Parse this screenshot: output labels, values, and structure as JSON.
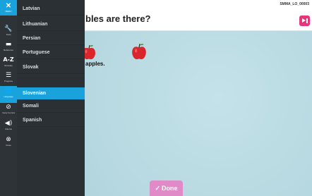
{
  "header": {
    "question_fragment": "bles are there?",
    "lo_code": "SMMA_LO_00003"
  },
  "workspace": {
    "answer_fragment": "apples."
  },
  "done_button": {
    "label": "Done",
    "icon": "check-icon"
  },
  "rail": {
    "menu": {
      "label": "MENU",
      "icon": "close-icon"
    },
    "items": [
      {
        "label": "Tools",
        "icon": "wrench-icon"
      },
      {
        "label": "Reference",
        "icon": "folder-icon"
      },
      {
        "label": "Glossary",
        "icon": "a-z-icon"
      },
      {
        "label": "Progress",
        "icon": "list-icon"
      },
      {
        "label": "Language",
        "icon": "globe-icon"
      },
      {
        "label": "Voice Control",
        "icon": "voice-icon"
      },
      {
        "label": "Volume",
        "icon": "speaker-icon"
      },
      {
        "label": "Close",
        "icon": "close-circle-icon"
      }
    ]
  },
  "languages": {
    "items": [
      "Latvian",
      "Lithuanian",
      "Persian",
      "Portuguese",
      "Slovak",
      "Slovenian",
      "Somali",
      "Spanish"
    ],
    "selected": "Slovenian"
  },
  "colors": {
    "accent_blue": "#1aa2dc",
    "panel_dark": "#2b3035",
    "apple_red": "#d8262c",
    "done_pink": "#e08ac8",
    "audio_pink": "#e8357a"
  }
}
